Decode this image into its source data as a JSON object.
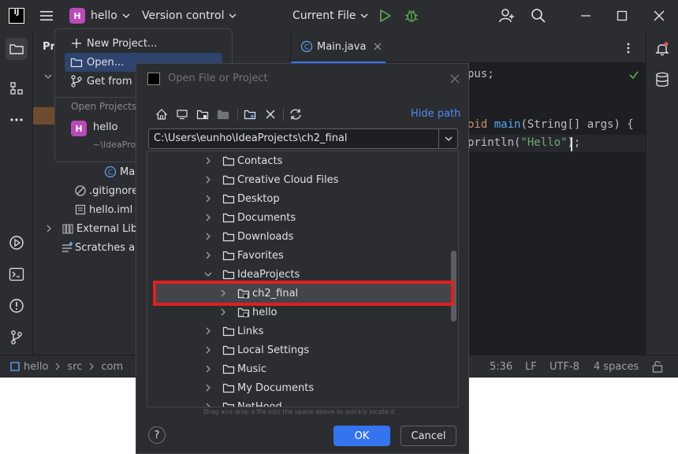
{
  "titlebar": {
    "logo": "IJ",
    "project_badge": "H",
    "project_name": "hello",
    "vcs_label": "Version control",
    "run_config": "Current File"
  },
  "menu": {
    "new_project": "New Project...",
    "open": "Open...",
    "get_from_vcs": "Get from V",
    "open_projects_header": "Open Projects",
    "recent_project_badge": "H",
    "recent_project_name": "hello",
    "recent_project_path": "~\\IdeaPro"
  },
  "project_panel": {
    "title": "Pr",
    "rows": {
      "main": "Mai",
      "gitignore": ".gitignore",
      "hello_iml": "hello.iml",
      "external_libs": "External Libr",
      "scratches": "Scratches ar"
    }
  },
  "editor": {
    "tab_label": "Main.java",
    "line1": "pus;",
    "line2_kw": "oid ",
    "line2_fn": "main",
    "line2_rest": "(String[] args) {",
    "line3_pre": "println(",
    "line3_str": "\"Hello\"",
    "line3_post": ");"
  },
  "statusbar": {
    "crumb_project": "hello",
    "crumb_src": "src",
    "crumb_com": "com",
    "position": "5:36",
    "line_sep": "LF",
    "encoding": "UTF-8",
    "indent": "4 spaces"
  },
  "dialog": {
    "title": "Open File or Project",
    "hide_path": "Hide path",
    "path_value": "C:\\Users\\eunho\\IdeaProjects\\ch2_final",
    "folders": [
      "Contacts",
      "Creative Cloud Files",
      "Desktop",
      "Documents",
      "Downloads",
      "Favorites",
      "IdeaProjects",
      "ch2_final",
      "hello",
      "Links",
      "Local Settings",
      "Music",
      "My Documents",
      "NetHood"
    ],
    "hint": "Drag and drop a file into the space above to quickly locate it",
    "help": "?",
    "ok": "OK",
    "cancel": "Cancel"
  },
  "colors": {
    "accent": "#3574f0",
    "selection_highlight": "#e02020",
    "project_badge": "#b94ab6",
    "run_green": "#57a64a",
    "string_green": "#6aab73",
    "keyword_orange": "#cf8e6d",
    "function_blue": "#56a8f5"
  }
}
